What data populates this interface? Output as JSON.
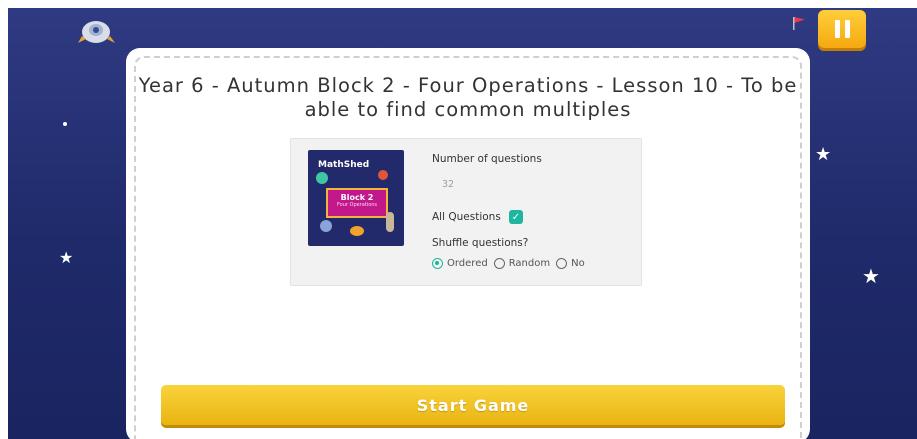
{
  "game": {
    "title": "Year 6 - Autumn Block 2 - Four Operations - Lesson 10 - To be able to find common multiples"
  },
  "thumbnail": {
    "brand": "MathShed",
    "plate_title": "Block 2",
    "plate_subtitle": "Four Operations"
  },
  "settings": {
    "num_questions_label": "Number of questions",
    "num_questions_value": "32",
    "all_questions_label": "All Questions",
    "all_questions_checked": true,
    "shuffle_label": "Shuffle questions?",
    "shuffle_options": [
      {
        "label": "Ordered",
        "selected": true
      },
      {
        "label": "Random",
        "selected": false
      },
      {
        "label": "No",
        "selected": false
      }
    ]
  },
  "start_button": {
    "label": "Start Game"
  },
  "icons": {
    "top_left": "rocket-icon",
    "flag": "flag-icon",
    "pause": "pause-icon",
    "checkbox": "check-icon"
  },
  "colors": {
    "background": "#2f3a82",
    "accent_yellow": "#f5c21b",
    "teal": "#1fb6a0",
    "flag_red": "#e23a4e"
  }
}
